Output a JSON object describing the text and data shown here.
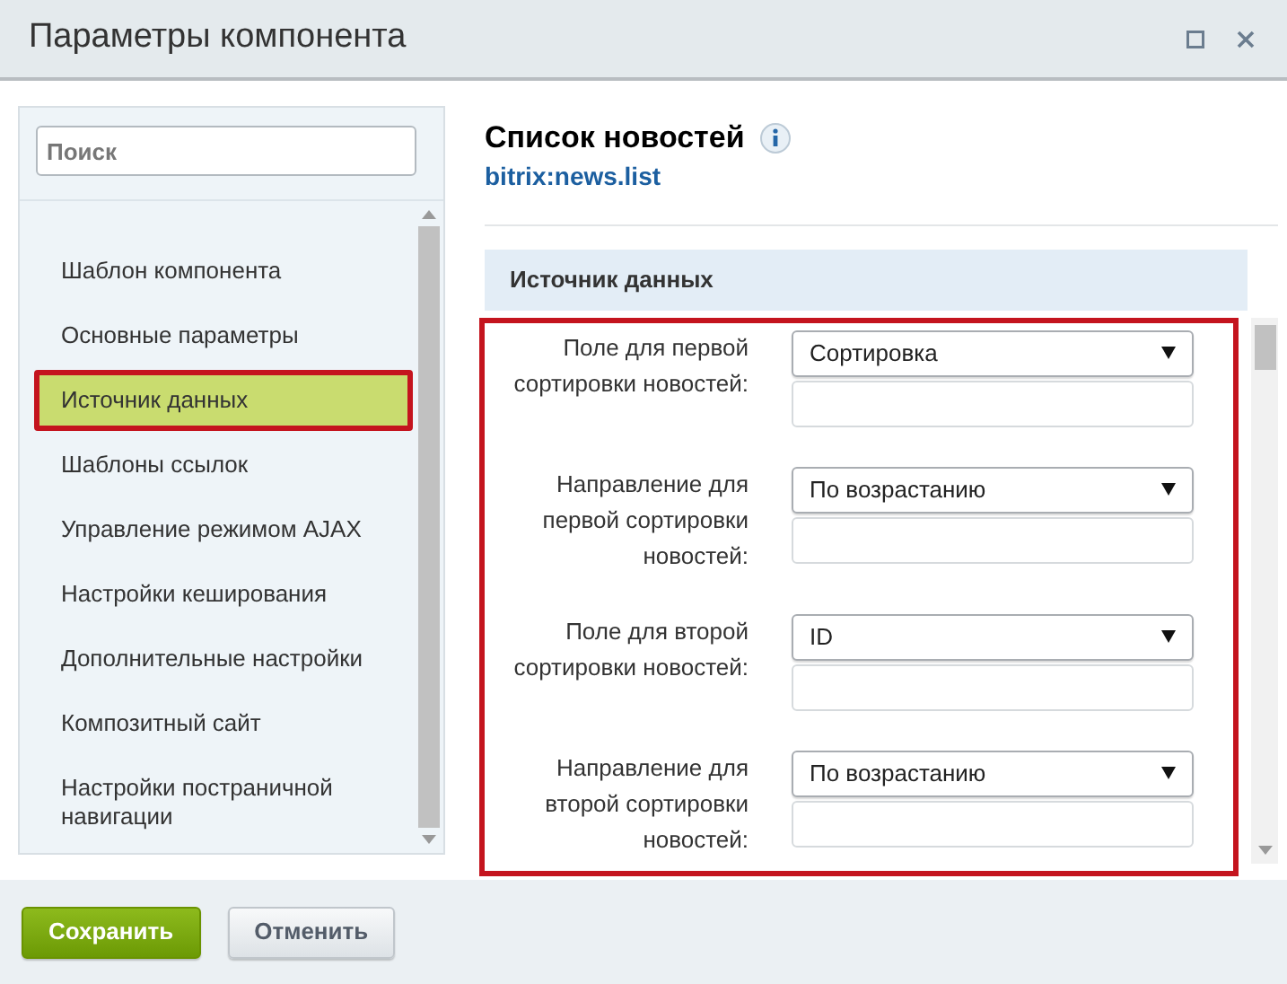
{
  "window": {
    "title": "Параметры компонента"
  },
  "search": {
    "placeholder": "Поиск"
  },
  "sidebar": {
    "items": [
      {
        "label": "Шаблон компонента",
        "selected": false
      },
      {
        "label": "Основные параметры",
        "selected": false
      },
      {
        "label": "Источник данных",
        "selected": true
      },
      {
        "label": "Шаблоны ссылок",
        "selected": false
      },
      {
        "label": "Управление режимом AJAX",
        "selected": false
      },
      {
        "label": "Настройки кеширования",
        "selected": false
      },
      {
        "label": "Дополнительные настройки",
        "selected": false
      },
      {
        "label": "Композитный сайт",
        "selected": false
      },
      {
        "label": "Настройки постраничной навигации",
        "selected": false
      }
    ]
  },
  "component": {
    "title": "Список новостей",
    "code": "bitrix:news.list"
  },
  "section": {
    "title": "Источник данных",
    "highlighted": true
  },
  "fields": [
    {
      "label": "Поле для первой сортировки новостей:",
      "value": "Сортировка"
    },
    {
      "label": "Направление для первой сортировки новостей:",
      "value": "По возрастанию"
    },
    {
      "label": "Поле для второй сортировки новостей:",
      "value": "ID"
    },
    {
      "label": "Направление для второй сортировки новостей:",
      "value": "По возрастанию"
    }
  ],
  "buttons": [
    {
      "label": "Сохранить",
      "kind": "primary"
    },
    {
      "label": "Отменить",
      "kind": "secondary"
    }
  ]
}
